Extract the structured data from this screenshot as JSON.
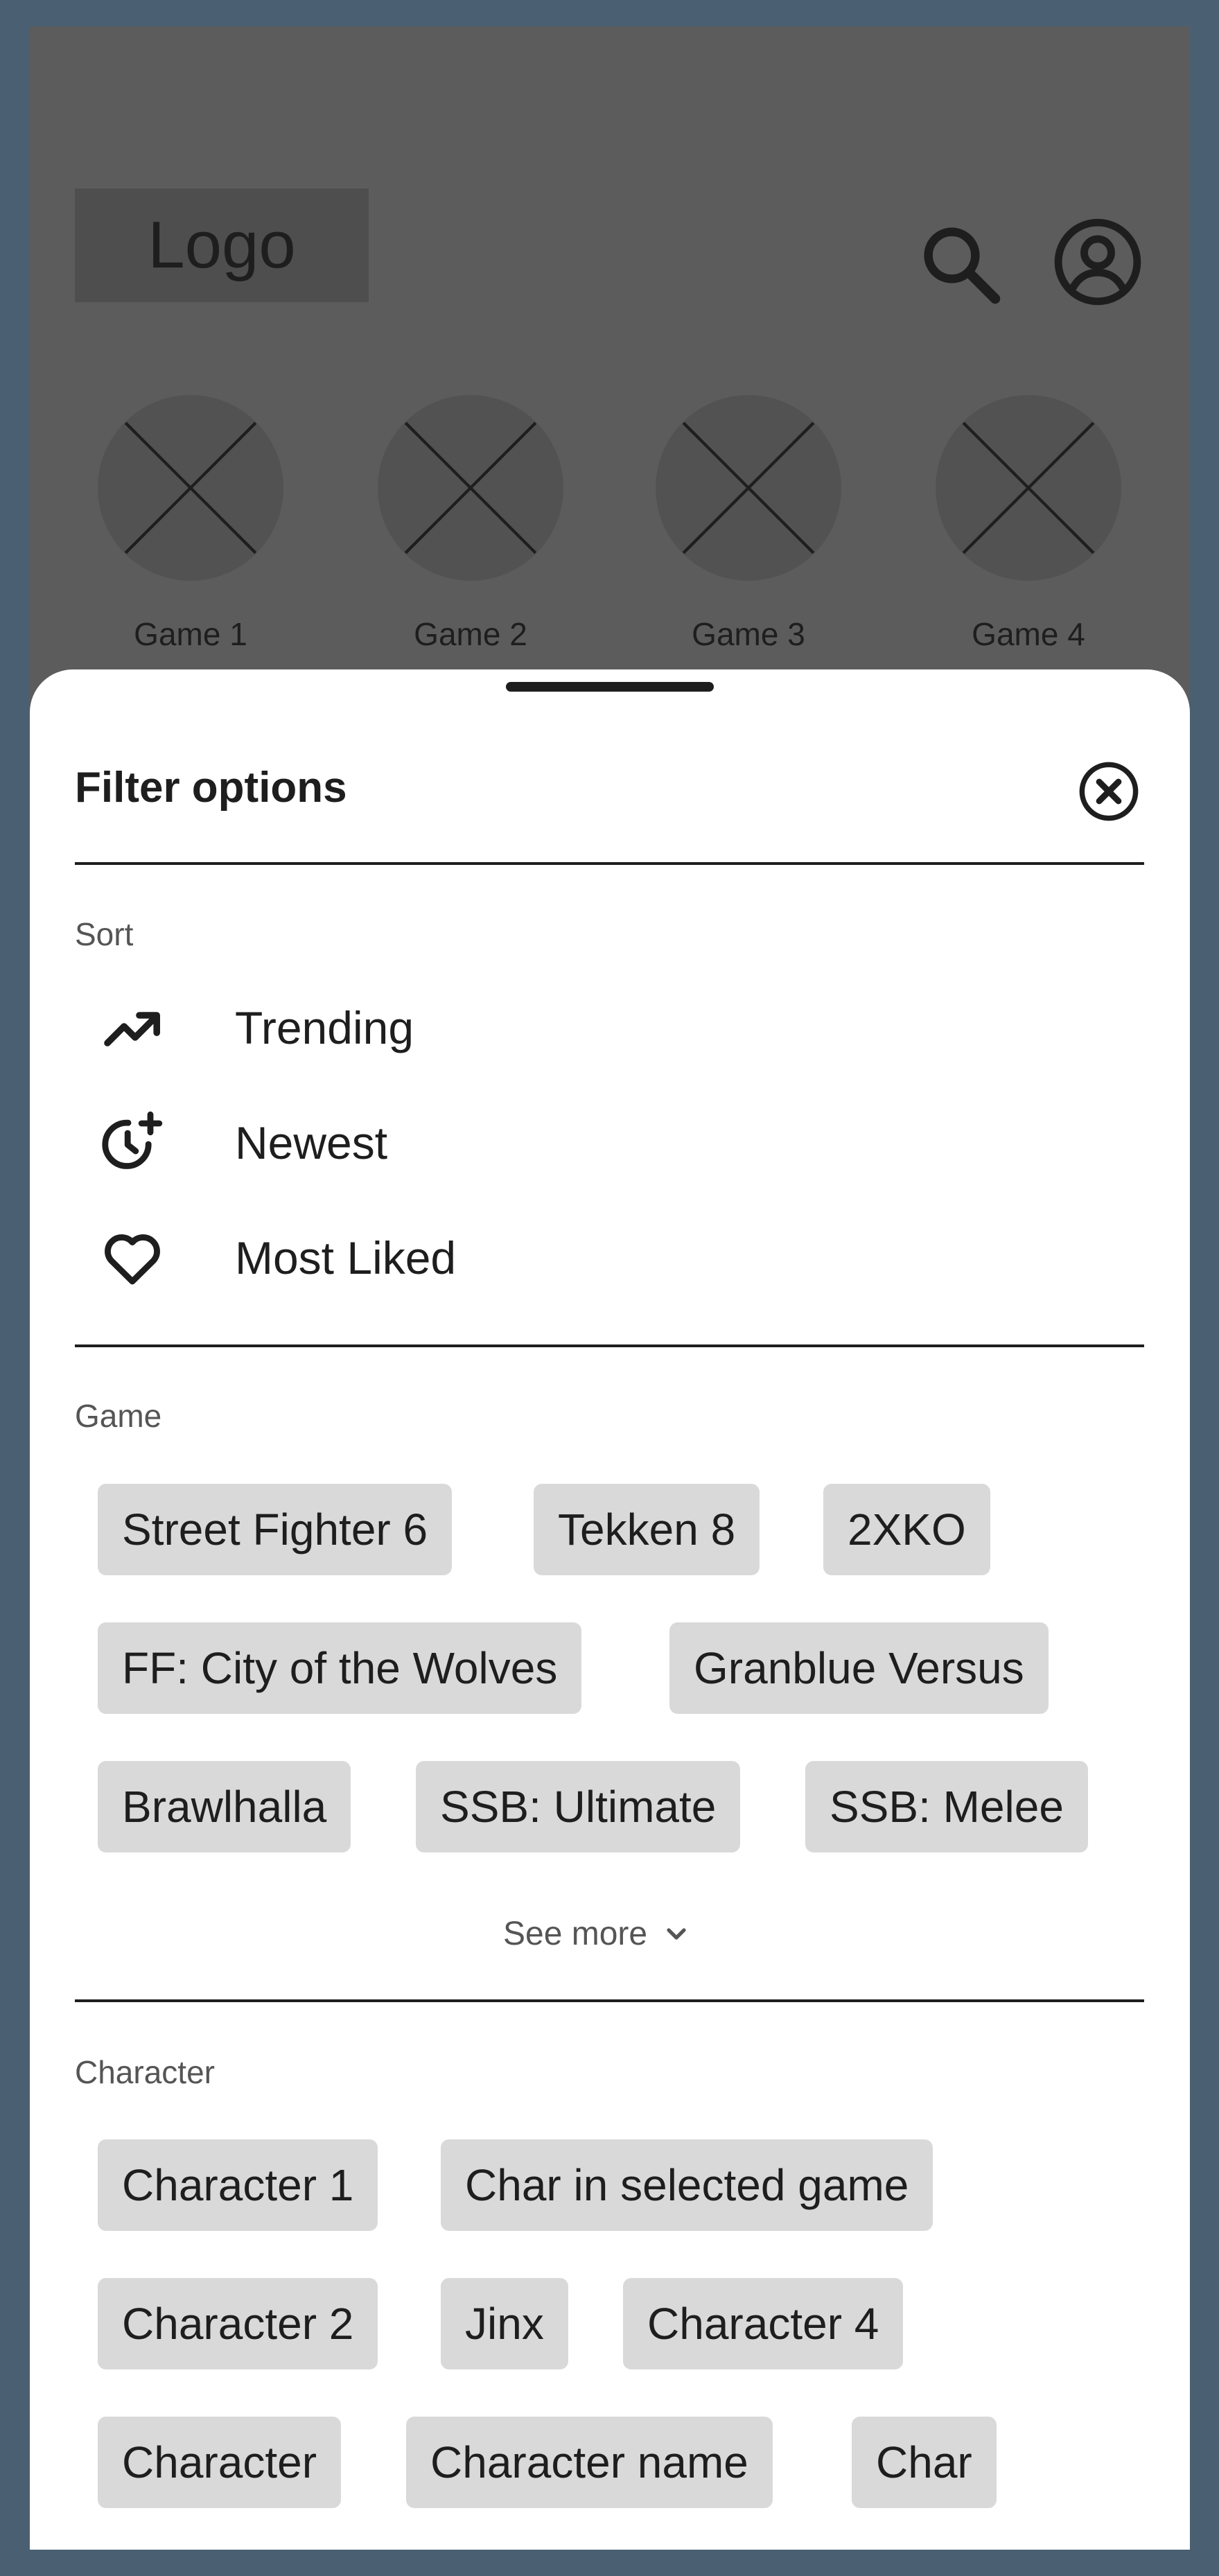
{
  "header": {
    "logo_text": "Logo",
    "search_icon": "search-icon",
    "account_icon": "account-circle-icon"
  },
  "games_row": [
    {
      "label": "Game 1",
      "icon": "image-placeholder-icon"
    },
    {
      "label": "Game 2",
      "icon": "image-placeholder-icon"
    },
    {
      "label": "Game 3",
      "icon": "image-placeholder-icon"
    },
    {
      "label": "Game 4",
      "icon": "image-placeholder-icon"
    }
  ],
  "filter_sheet": {
    "title": "Filter options",
    "close_icon": "close-circle-icon",
    "sort": {
      "label": "Sort",
      "options": [
        {
          "label": "Trending",
          "icon": "trending-up-icon"
        },
        {
          "label": "Newest",
          "icon": "clock-plus-icon"
        },
        {
          "label": "Most Liked",
          "icon": "heart-icon"
        }
      ]
    },
    "game": {
      "label": "Game",
      "chips": [
        "Street Fighter 6",
        "Tekken 8",
        "2XKO",
        "FF: City of the Wolves",
        "Granblue Versus",
        "Brawlhalla",
        "SSB: Ultimate",
        "SSB: Melee"
      ],
      "see_more": "See more",
      "see_more_icon": "chevron-down-icon"
    },
    "character": {
      "label": "Character",
      "chips": [
        "Character 1",
        "Char in selected game",
        "Character 2",
        "Jinx",
        "Character 4",
        "Character",
        "Character name",
        "Char"
      ]
    }
  },
  "colors": {
    "background": "#4a5f72",
    "overlay": "#5c5c5c",
    "chip": "#d9d9d9",
    "text": "#1e1e1e"
  }
}
